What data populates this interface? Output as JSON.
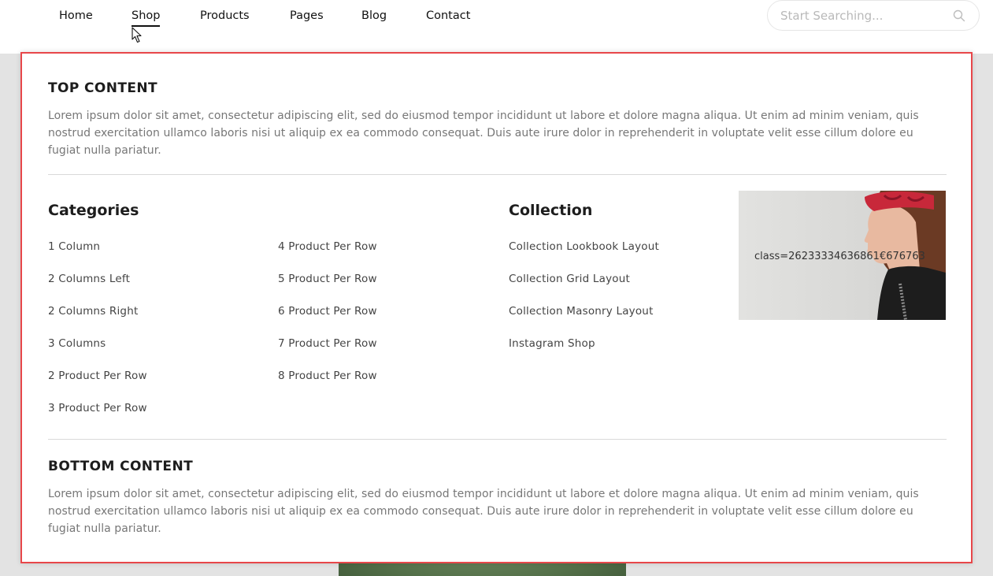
{
  "nav": {
    "items": [
      "Home",
      "Shop",
      "Products",
      "Pages",
      "Blog",
      "Contact"
    ],
    "active": "Shop"
  },
  "search": {
    "placeholder": "Start Searching..."
  },
  "menu": {
    "top": {
      "title": "TOP CONTENT",
      "text": "Lorem ipsum dolor sit amet, consectetur adipiscing elit, sed do eiusmod tempor incididunt ut labore et dolore magna aliqua. Ut enim ad minim veniam, quis nostrud exercitation ullamco laboris nisi ut aliquip ex ea commodo consequat. Duis aute irure dolor in reprehenderit in voluptate velit esse cillum dolore eu fugiat nulla pariatur."
    },
    "categories": {
      "heading": "Categories",
      "col1": [
        "1 Column",
        "2 Columns Left",
        "2 Columns Right",
        "3 Columns",
        "2 Product Per Row",
        "3 Product Per Row"
      ],
      "col2": [
        "4 Product Per Row",
        "5 Product Per Row",
        "6 Product Per Row",
        "7 Product Per Row",
        "8 Product Per Row"
      ]
    },
    "collection": {
      "heading": "Collection",
      "items": [
        "Collection Lookbook Layout",
        "Collection Grid Layout",
        "Collection Masonry Layout",
        "Instagram Shop"
      ]
    },
    "promo": {
      "overlay_text": "class=26233334636861€676763"
    },
    "bottom": {
      "title": "BOTTOM CONTENT",
      "text": "Lorem ipsum dolor sit amet, consectetur adipiscing elit, sed do eiusmod tempor incididunt ut labore et dolore magna aliqua. Ut enim ad minim veniam, quis nostrud exercitation ullamco laboris nisi ut aliquip ex ea commodo consequat. Duis aute irure dolor in reprehenderit in voluptate velit esse cillum dolore eu fugiat nulla pariatur."
    }
  },
  "colors": {
    "highlight_border": "#e8474a",
    "hair_band": "#c8283a"
  },
  "icons": {
    "search": "search-icon",
    "cursor": "mouse-cursor-icon"
  }
}
